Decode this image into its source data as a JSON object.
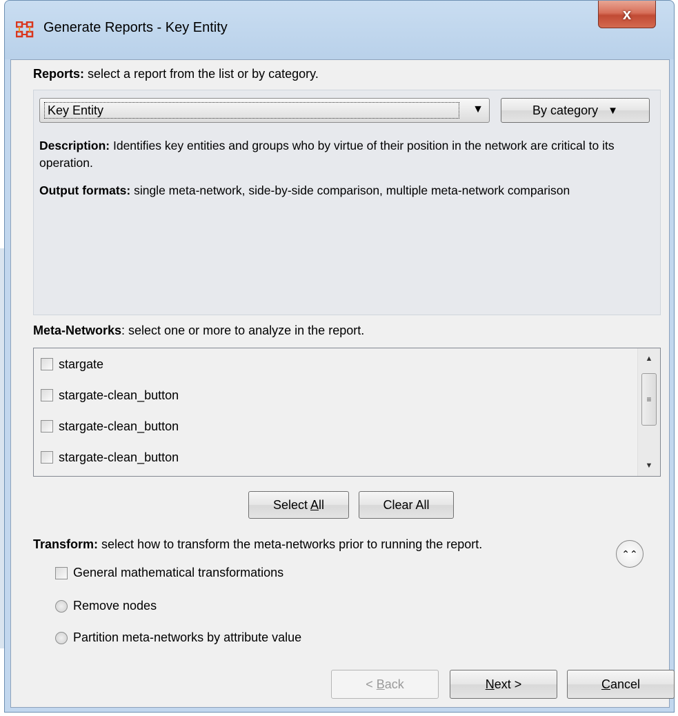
{
  "window": {
    "title": "Generate Reports - Key Entity",
    "close_label": "x"
  },
  "reports": {
    "heading_bold": "Reports:",
    "heading_rest": " select a report from the list or by category.",
    "selected_report": "Key Entity",
    "by_category_label": "By category",
    "description_label": "Description:",
    "description_text": " Identifies key entities and groups who by virtue of their position in the network are critical to its operation.",
    "output_label": "Output formats:",
    "output_text": " single meta-network, side-by-side comparison, multiple meta-network comparison"
  },
  "meta_networks": {
    "heading_bold": "Meta-Networks",
    "heading_rest": ": select one or more to analyze in the report.",
    "items": [
      {
        "label": "stargate",
        "checked": false
      },
      {
        "label": "stargate-clean_button",
        "checked": false
      },
      {
        "label": "stargate-clean_button",
        "checked": false
      },
      {
        "label": "stargate-clean_button",
        "checked": false
      }
    ],
    "select_all_label": "Select All",
    "select_all_mnemonic": "A",
    "clear_all_label": "Clear All"
  },
  "transform": {
    "heading_bold": "Transform:",
    "heading_rest": " select how to transform the meta-networks prior to running the report.",
    "options": [
      {
        "type": "checkbox",
        "label": "General mathematical transformations",
        "checked": false
      },
      {
        "type": "radio",
        "label": "Remove nodes",
        "checked": false
      },
      {
        "type": "radio",
        "label": "Partition meta-networks by attribute value",
        "checked": false
      }
    ]
  },
  "footer": {
    "back_label": "< Back",
    "next_label": "Next >",
    "cancel_label": "Cancel"
  },
  "icons": {
    "app": "network-grid-icon",
    "dropdown": "triangle-down-icon",
    "collapse": "double-chevron-up-icon"
  },
  "colors": {
    "title_gradient_top": "#c9ddf1",
    "close_red": "#c14a34",
    "panel_bg": "#e7e9ed",
    "client_bg": "#f0f0f0",
    "app_icon": "#d9361e"
  }
}
